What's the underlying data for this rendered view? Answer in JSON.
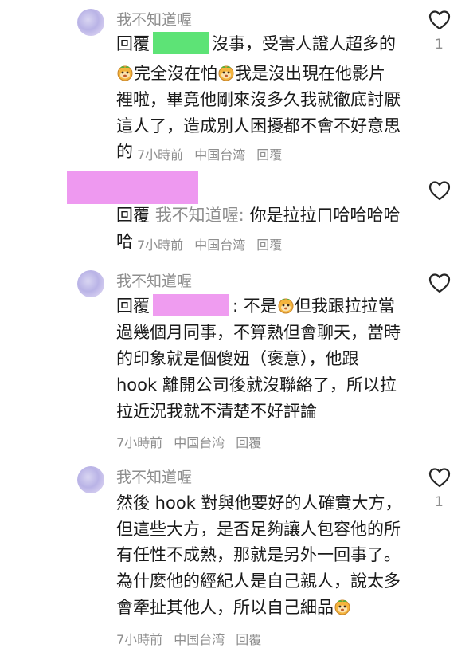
{
  "comments": [
    {
      "username": "我不知道喔",
      "reply_prefix": "回覆",
      "lines": [
        "沒事，受害人證人超多的",
        "完全沒在怕",
        "我是沒出現在他影片",
        "裡啦，畢竟他剛來沒多久我就徹底討厭",
        "這人了，造成別人困擾都不會不好意思",
        "的"
      ],
      "time": "7小時前",
      "location": "中国台湾",
      "reply_label": "回覆",
      "likes": "1"
    },
    {
      "reply_prefix": "回覆",
      "mention_name": "我不知道喔:",
      "line1": "你是拉拉ㄇ哈哈哈哈",
      "line2": "哈",
      "time": "7小時前",
      "location": "中国台湾",
      "reply_label": "回覆"
    },
    {
      "username": "我不知道喔",
      "reply_prefix": "回覆",
      "lines": [
        ": 不是",
        "但我跟拉拉當",
        "過幾個月同事，不算熟但會聊天，當時",
        "的印象就是個傻妞（褒意），他跟",
        "hook 離開公司後就沒聯絡了，所以拉",
        "拉近況我就不清楚不好評論"
      ],
      "time": "7小時前",
      "location": "中国台湾",
      "reply_label": "回覆"
    },
    {
      "username": "我不知道喔",
      "lines": [
        "然後 hook 對與他要好的人確實大方，",
        "但這些大方，是否足夠讓人包容他的所",
        "有任性不成熟，那就是另外一回事了。",
        "為什麼他的經紀人是自己親人，說太多",
        "會牽扯其他人，所以自己細品"
      ],
      "time": "7小時前",
      "location": "中国台湾",
      "reply_label": "回覆",
      "likes": "1"
    }
  ],
  "icons": {
    "like": "heart-outline-icon",
    "emoji": "face-emoji-icon",
    "avatar": "avatar"
  }
}
